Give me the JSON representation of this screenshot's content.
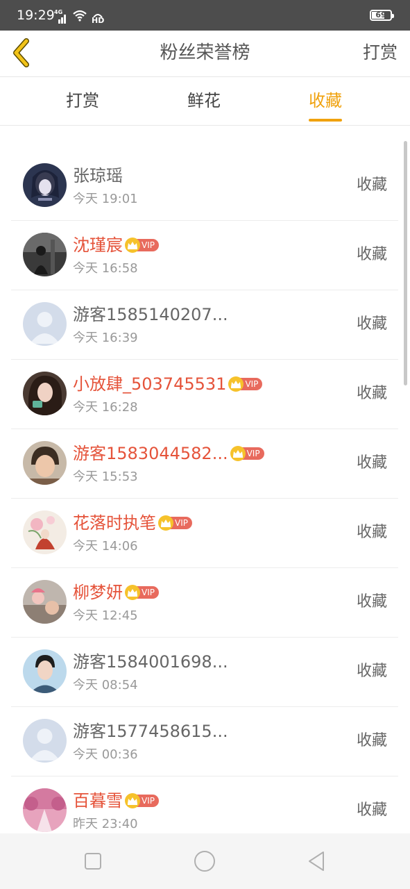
{
  "status_bar": {
    "time": "19:29",
    "network_label": "4G",
    "hd_label": "HD",
    "battery_level": "69"
  },
  "header": {
    "title": "粉丝荣誉榜",
    "right_action": "打赏"
  },
  "tabs": [
    {
      "label": "打赏",
      "active": false
    },
    {
      "label": "鲜花",
      "active": false
    },
    {
      "label": "收藏",
      "active": true
    }
  ],
  "vip_label": "VIP",
  "users": [
    {
      "name": "张琼瑶",
      "time": "今天 19:01",
      "vip": false,
      "action": "收藏",
      "avatar": "photo-dark-blue"
    },
    {
      "name": "沈瑾宸",
      "time": "今天 16:58",
      "vip": true,
      "action": "收藏",
      "avatar": "photo-black-white"
    },
    {
      "name": "游客1585140207...",
      "time": "今天 16:39",
      "vip": false,
      "action": "收藏",
      "avatar": "default-user-icon"
    },
    {
      "name": "小放肆_503745531",
      "time": "今天 16:28",
      "vip": true,
      "action": "收藏",
      "avatar": "photo-girl"
    },
    {
      "name": "游客1583044582...",
      "time": "今天 15:53",
      "vip": true,
      "action": "收藏",
      "avatar": "photo-child"
    },
    {
      "name": "花落时执笔",
      "time": "今天 14:06",
      "vip": true,
      "action": "收藏",
      "avatar": "photo-flowers"
    },
    {
      "name": "柳梦妍",
      "time": "今天 12:45",
      "vip": true,
      "action": "收藏",
      "avatar": "photo-baby"
    },
    {
      "name": "游客1584001698...",
      "time": "今天 08:54",
      "vip": false,
      "action": "收藏",
      "avatar": "photo-man"
    },
    {
      "name": "游客1577458615...",
      "time": "今天 00:36",
      "vip": false,
      "action": "收藏",
      "avatar": "default-user-icon"
    },
    {
      "name": "百暮雪",
      "time": "昨天 23:40",
      "vip": true,
      "action": "收藏",
      "avatar": "photo-pink-trees"
    }
  ],
  "colors": {
    "accent": "#f0a20e",
    "vip_name": "#e5533a",
    "vip_badge": "#e86a5d",
    "crown": "#f6c22b"
  }
}
